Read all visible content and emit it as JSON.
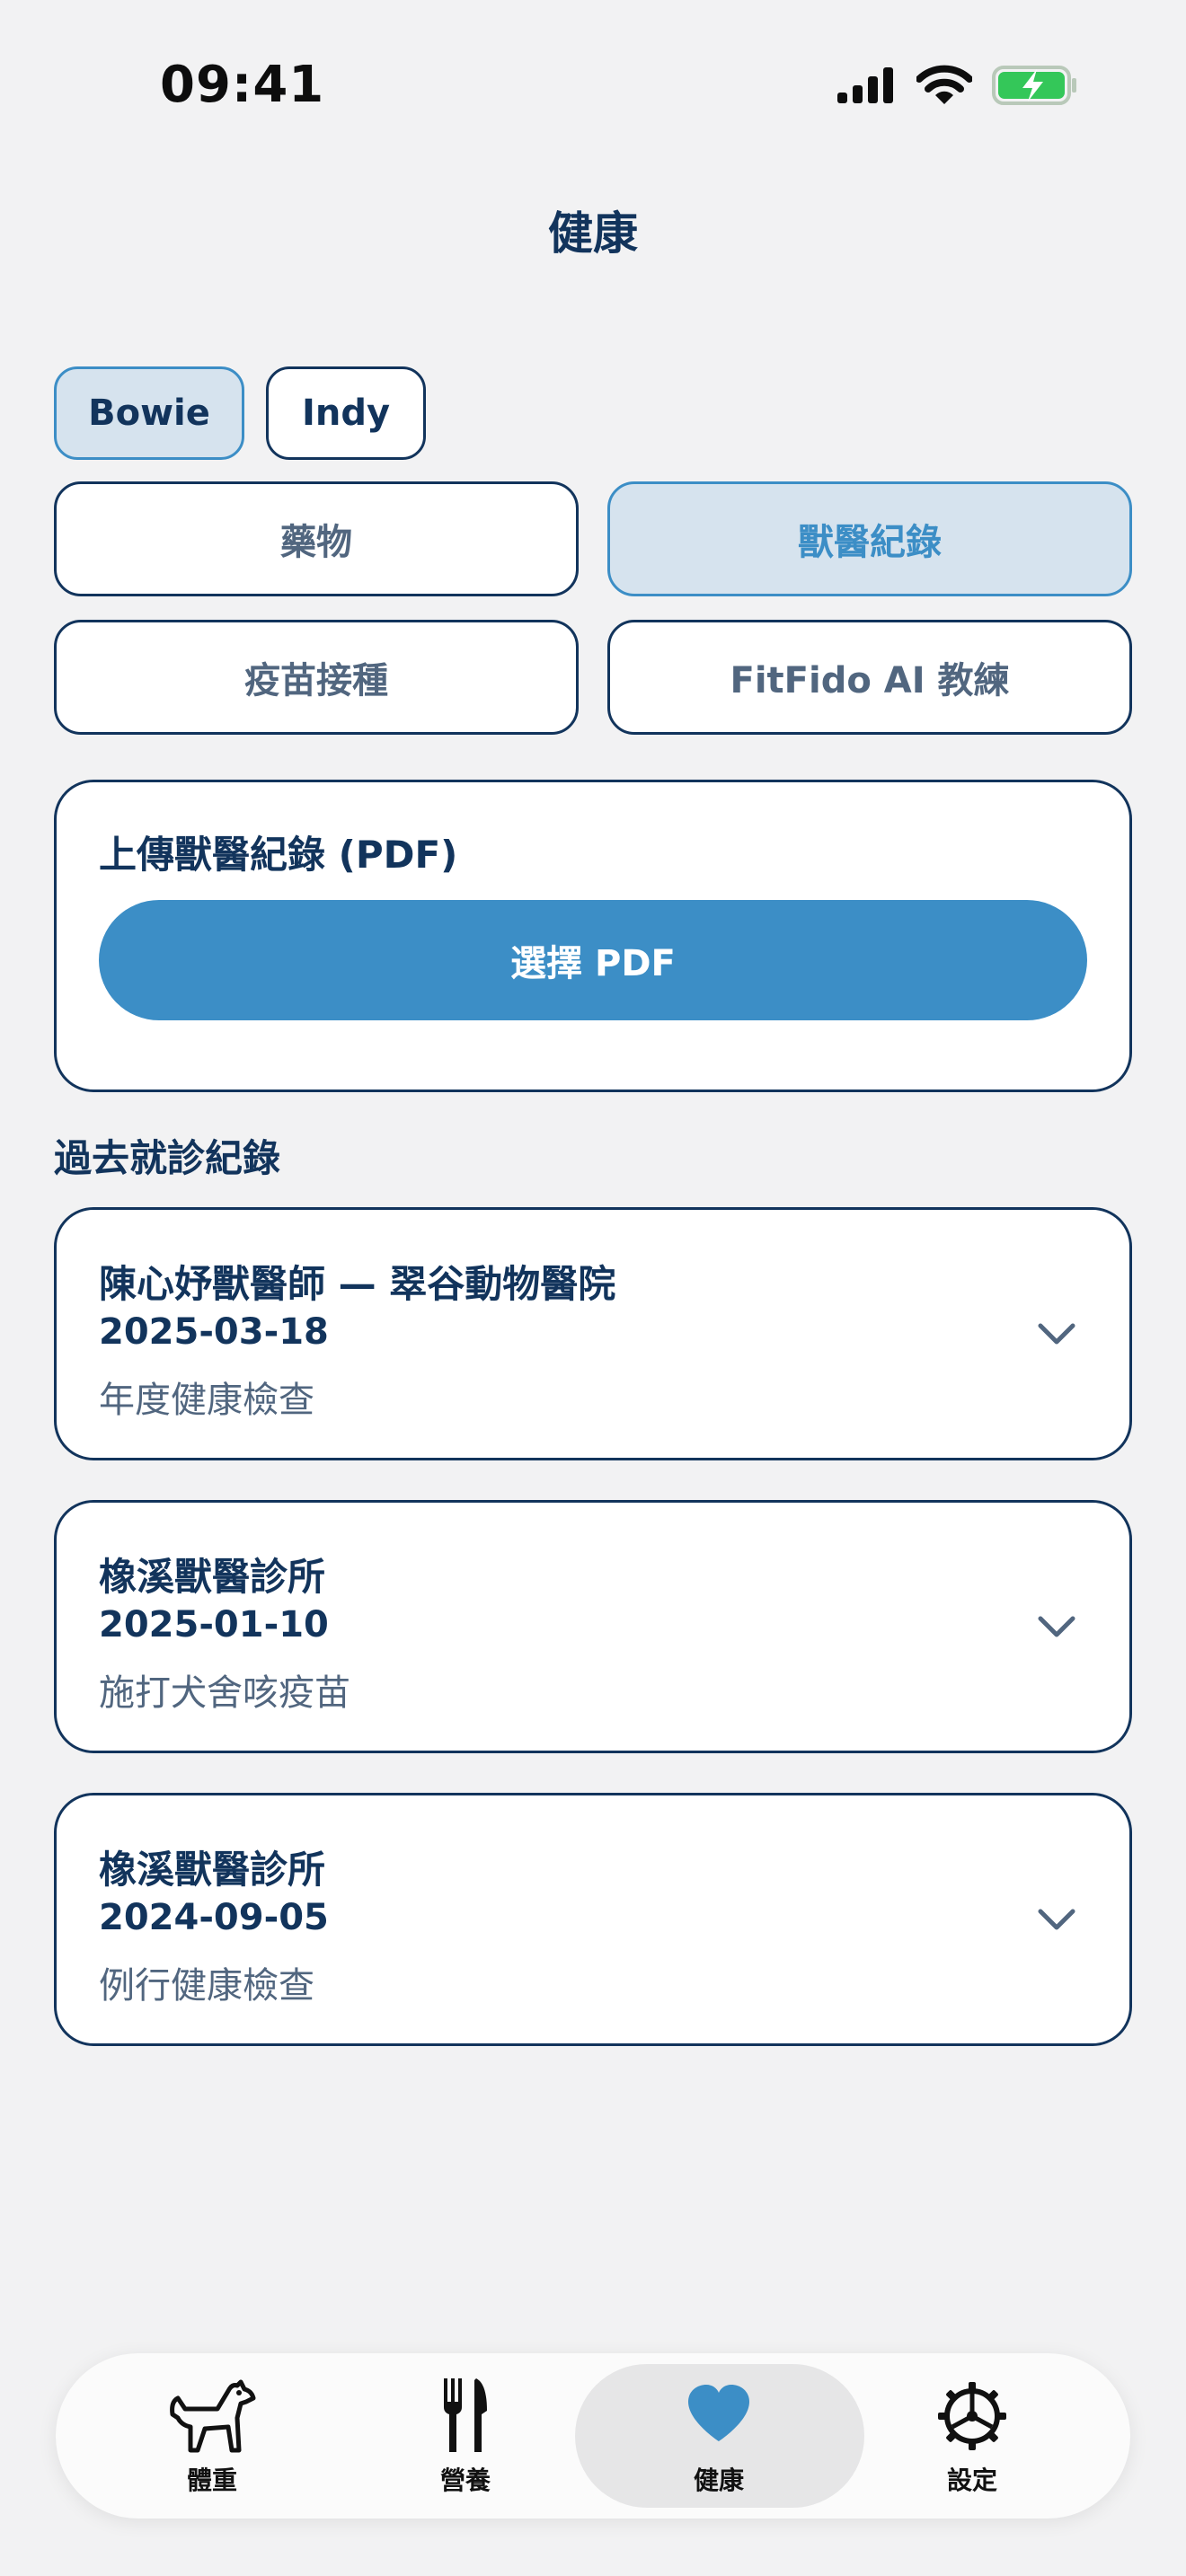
{
  "status_bar": {
    "time": "09:41"
  },
  "header": {
    "title": "健康"
  },
  "pets": [
    {
      "name": "Bowie",
      "selected": true
    },
    {
      "name": "Indy",
      "selected": false
    }
  ],
  "segments": [
    {
      "label": "藥物",
      "selected": false
    },
    {
      "label": "獸醫紀錄",
      "selected": true
    },
    {
      "label": "疫苗接種",
      "selected": false
    },
    {
      "label": "FitFido AI 教練",
      "selected": false
    }
  ],
  "upload": {
    "title": "上傳獸醫紀錄 (PDF)",
    "button_label": "選擇 PDF"
  },
  "history": {
    "title": "過去就診紀錄",
    "records": [
      {
        "clinic": "陳心妤獸醫師 — 翠谷動物醫院",
        "date": "2025-03-18",
        "description": "年度健康檢查"
      },
      {
        "clinic": "橡溪獸醫診所",
        "date": "2025-01-10",
        "description": "施打犬舍咳疫苗"
      },
      {
        "clinic": "橡溪獸醫診所",
        "date": "2024-09-05",
        "description": "例行健康檢查"
      }
    ]
  },
  "tabbar": {
    "tabs": [
      {
        "label": "體重",
        "icon": "dog-icon"
      },
      {
        "label": "營養",
        "icon": "fork-knife-icon"
      },
      {
        "label": "健康",
        "icon": "heart-icon",
        "active": true
      },
      {
        "label": "設定",
        "icon": "gear-icon"
      }
    ]
  },
  "colors": {
    "accent": "#3c8ec6",
    "navy": "#12345c",
    "muted": "#51667f",
    "selected_bg": "#d6e3ee",
    "battery": "#34c759"
  }
}
